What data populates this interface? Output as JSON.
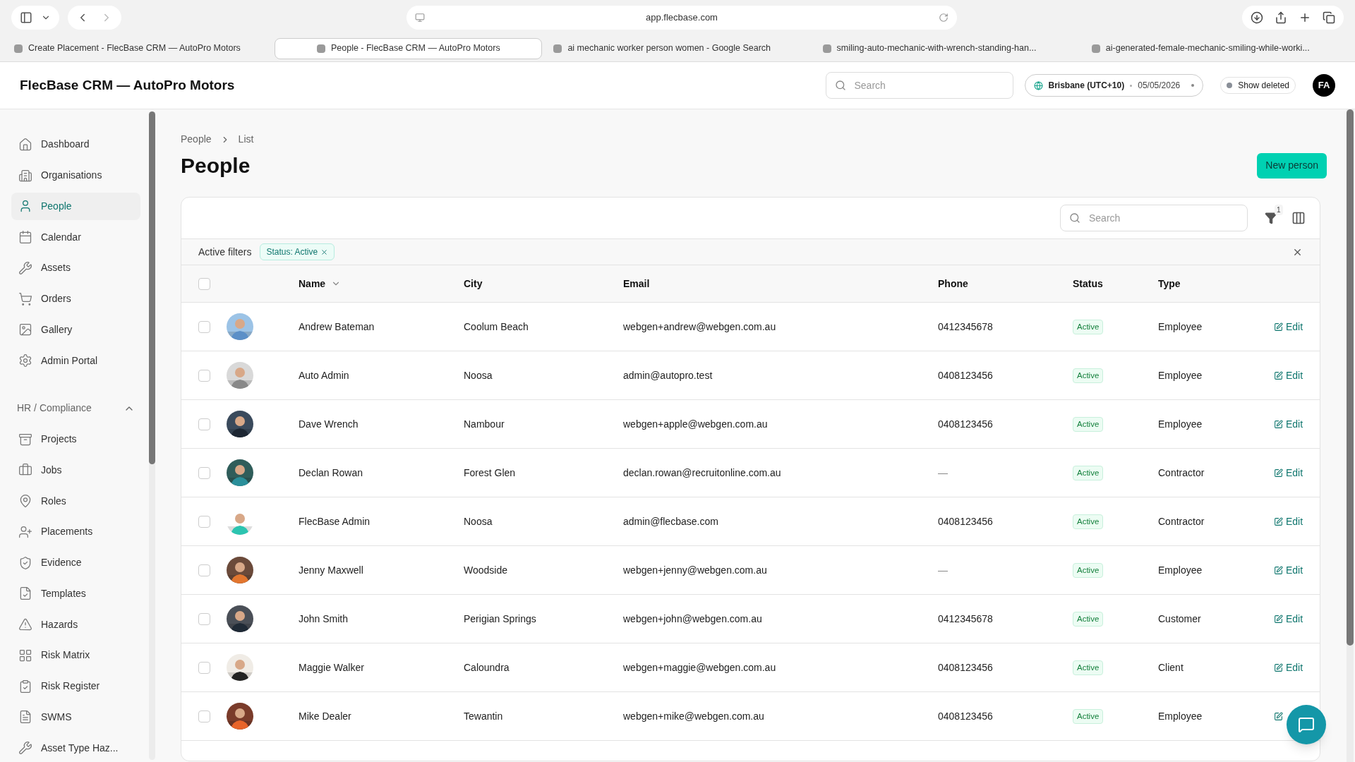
{
  "browser": {
    "url": "app.flecbase.com",
    "tabs": [
      {
        "title": "Create Placement - FlecBase CRM — AutoPro Motors",
        "selected": false
      },
      {
        "title": "People - FlecBase CRM — AutoPro Motors",
        "selected": true
      },
      {
        "title": "ai mechanic worker person women - Google Search",
        "selected": false
      },
      {
        "title": "smiling-auto-mechanic-with-wrench-standing-han...",
        "selected": false
      },
      {
        "title": "ai-generated-female-mechanic-smiling-while-worki...",
        "selected": false
      }
    ]
  },
  "header": {
    "app_title": "FlecBase CRM — AutoPro Motors",
    "search": {
      "placeholder": "Search"
    },
    "timezone": "Brisbane (UTC+10)",
    "date": "05/05/2026",
    "show_deleted": {
      "label": "Show deleted",
      "on": false
    },
    "avatar": "FA"
  },
  "sidebar": {
    "items": [
      {
        "label": "Dashboard",
        "selected": false
      },
      {
        "label": "Organisations",
        "selected": false
      },
      {
        "label": "People",
        "selected": true
      },
      {
        "label": "Calendar",
        "selected": false
      },
      {
        "label": "Assets",
        "selected": false
      },
      {
        "label": "Orders",
        "selected": false
      },
      {
        "label": "Gallery",
        "selected": false
      },
      {
        "label": "Admin Portal",
        "selected": false
      }
    ],
    "group": {
      "label": "HR / Compliance",
      "expanded": true,
      "items": [
        {
          "label": "Projects",
          "selected": false
        },
        {
          "label": "Jobs",
          "selected": false
        },
        {
          "label": "Roles",
          "selected": false
        },
        {
          "label": "Placements",
          "selected": false
        },
        {
          "label": "Evidence",
          "selected": false
        },
        {
          "label": "Templates",
          "selected": false
        },
        {
          "label": "Hazards",
          "selected": false
        },
        {
          "label": "Risk Matrix",
          "selected": false
        },
        {
          "label": "Risk Register",
          "selected": false
        },
        {
          "label": "SWMS",
          "selected": false
        },
        {
          "label": "Asset Type Haz...",
          "selected": false
        }
      ]
    }
  },
  "breadcrumb": [
    "People",
    "List"
  ],
  "page_title": "People",
  "new_button": "New person",
  "table": {
    "search": {
      "placeholder": "Search"
    },
    "filter_count": "1",
    "active_filters_label": "Active filters",
    "filters": [
      "Status: Active"
    ],
    "select_all_checked": false,
    "columns": [
      "Name",
      "City",
      "Email",
      "Phone",
      "Status",
      "Type"
    ],
    "rows": [
      {
        "name": "Andrew Bateman",
        "city": "Coolum Beach",
        "email": "webgen+andrew@webgen.com.au",
        "phone": "0412345678",
        "status": "Active",
        "type": "Employee",
        "edit": "Edit",
        "checked": false
      },
      {
        "name": "Auto Admin",
        "city": "Noosa",
        "email": "admin@autopro.test",
        "phone": "0408123456",
        "status": "Active",
        "type": "Employee",
        "edit": "Edit",
        "checked": false
      },
      {
        "name": "Dave Wrench",
        "city": "Nambour",
        "email": "webgen+apple@webgen.com.au",
        "phone": "0408123456",
        "status": "Active",
        "type": "Employee",
        "edit": "Edit",
        "checked": false
      },
      {
        "name": "Declan Rowan",
        "city": "Forest Glen",
        "email": "declan.rowan@recruitonline.com.au",
        "phone": "—",
        "status": "Active",
        "type": "Contractor",
        "edit": "Edit",
        "checked": false
      },
      {
        "name": "FlecBase Admin",
        "city": "Noosa",
        "email": "admin@flecbase.com",
        "phone": "0408123456",
        "status": "Active",
        "type": "Contractor",
        "edit": "Edit",
        "checked": false
      },
      {
        "name": "Jenny Maxwell",
        "city": "Woodside",
        "email": "webgen+jenny@webgen.com.au",
        "phone": "—",
        "status": "Active",
        "type": "Employee",
        "edit": "Edit",
        "checked": false
      },
      {
        "name": "John Smith",
        "city": "Perigian Springs",
        "email": "webgen+john@webgen.com.au",
        "phone": "0412345678",
        "status": "Active",
        "type": "Customer",
        "edit": "Edit",
        "checked": false
      },
      {
        "name": "Maggie Walker",
        "city": "Caloundra",
        "email": "webgen+maggie@webgen.com.au",
        "phone": "0408123456",
        "status": "Active",
        "type": "Client",
        "edit": "Edit",
        "checked": false
      },
      {
        "name": "Mike Dealer",
        "city": "Tewantin",
        "email": "webgen+mike@webgen.com.au",
        "phone": "0408123456",
        "status": "Active",
        "type": "Employee",
        "checked": false
      }
    ]
  }
}
